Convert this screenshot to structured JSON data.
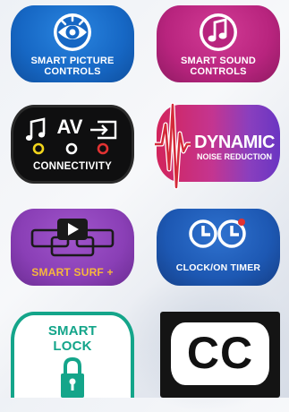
{
  "tiles": {
    "smart_picture": {
      "line1": "SMART PICTURE",
      "line2": "CONTROLS",
      "icon": "eye-icon",
      "color": "#1667c4"
    },
    "smart_sound": {
      "line1": "SMART SOUND",
      "line2": "CONTROLS",
      "icon": "music-note-icon",
      "color": "#b8247e"
    },
    "av_connectivity": {
      "label": "CONNECTIVITY",
      "av_text": "AV",
      "icon": "av-ports-icon",
      "color": "#111111"
    },
    "dynamic_noise": {
      "line1": "DYNAMIC",
      "line2": "NOISE REDUCTION",
      "icon": "waveform-icon",
      "color_start": "#d2245c",
      "color_end": "#6a35c2"
    },
    "smart_surf": {
      "label": "SMART SURF +",
      "icon": "play-window-icon",
      "color": "#8a3fb6",
      "label_color": "#f6b73c"
    },
    "clock_timer": {
      "label": "CLOCK/ON TIMER",
      "icon": "clock-icon",
      "color": "#1d58b3"
    },
    "smart_lock": {
      "line1": "SMART",
      "line2": "LOCK",
      "icon": "padlock-icon",
      "color": "#14a58a"
    },
    "closed_caption": {
      "text": "CC",
      "icon": "closed-caption-icon",
      "color": "#111111"
    }
  }
}
